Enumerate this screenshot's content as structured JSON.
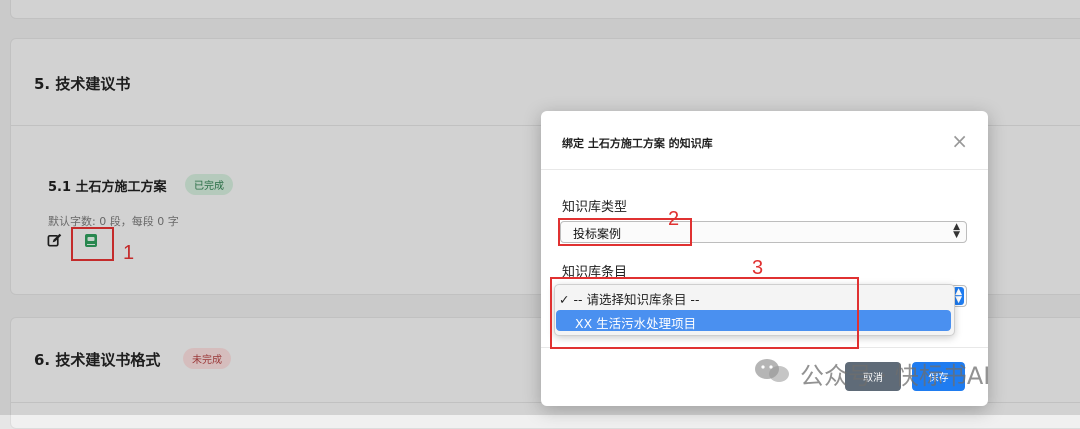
{
  "sections": {
    "s5": {
      "title": "5. 技术建议书",
      "item_title": "5.1 土石方施工方案",
      "item_status": "已完成",
      "item_meta": "默认字数: 0 段，每段 0 字"
    },
    "s6": {
      "title": "6. 技术建议书格式",
      "status": "未完成"
    }
  },
  "icons": {
    "edit": "edit-icon",
    "book": "book-icon",
    "close": "close-icon",
    "wechat": "wechat-icon"
  },
  "annotations": {
    "one": "1",
    "two": "2",
    "three": "3"
  },
  "modal": {
    "title": "绑定 土石方施工方案 的知识库",
    "close_glyph": "×",
    "kb_type_label": "知识库类型",
    "kb_type_value": "投标案例",
    "kb_item_label": "知识库条目",
    "dropdown_options": [
      "-- 请选择知识库条目 --",
      "XX 生活污水处理项目"
    ],
    "selected_check": "✓",
    "cancel_label": "取消",
    "save_label": "保存"
  },
  "watermark": {
    "text": "公众号 · 快标书AI"
  },
  "colors": {
    "annotation_red": "#e03131",
    "primary_blue": "#1f7cf0",
    "option_highlight": "#4a90f0",
    "success_green": "#2e7d4f",
    "danger_red": "#b04040"
  }
}
